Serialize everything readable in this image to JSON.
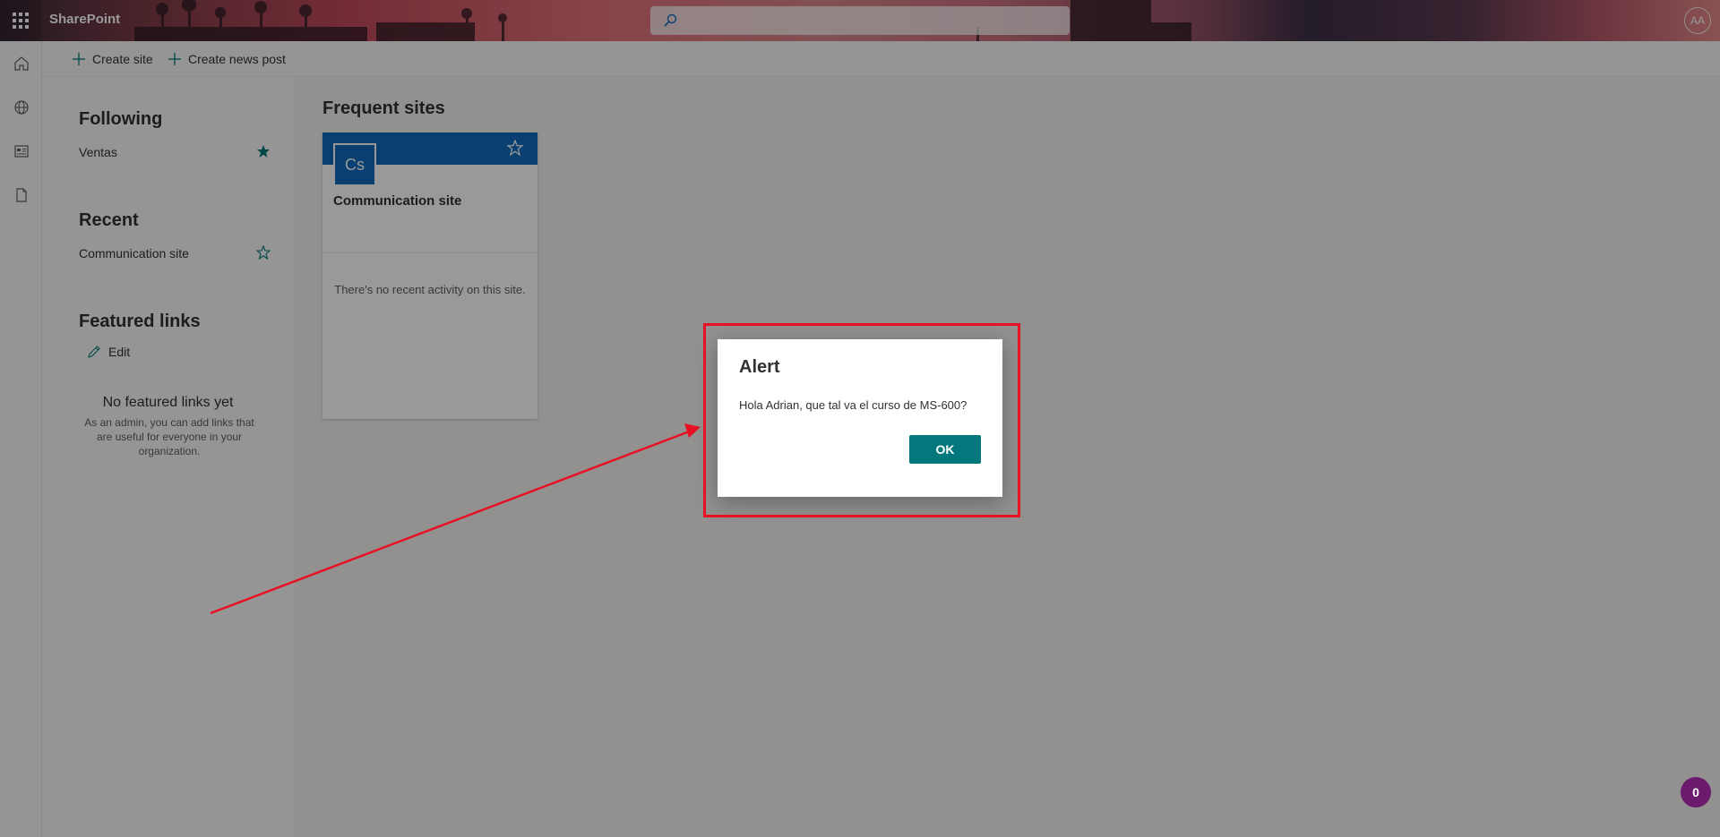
{
  "suite_bar": {
    "app_name": "SharePoint",
    "search_placeholder": "",
    "avatar_initials": "AA"
  },
  "app_bar": {
    "icons": [
      "home-icon",
      "globe-icon",
      "news-icon",
      "document-icon"
    ]
  },
  "command_bar": {
    "create_site": "Create site",
    "create_news_post": "Create news post"
  },
  "left_panel": {
    "following_title": "Following",
    "following_items": [
      {
        "label": "Ventas",
        "starred": true
      }
    ],
    "recent_title": "Recent",
    "recent_items": [
      {
        "label": "Communication site",
        "starred": false
      }
    ],
    "featured_title": "Featured links",
    "edit_label": "Edit",
    "empty_title": "No featured links yet",
    "empty_desc": "As an admin, you can add links that are useful for everyone in your organization."
  },
  "main": {
    "frequent_title": "Frequent sites",
    "card": {
      "logo_text": "Cs",
      "name": "Communication site",
      "activity": "There's no recent activity on this site."
    }
  },
  "dialog": {
    "title": "Alert",
    "message": "Hola Adrian, que tal va el curso de MS-600?",
    "ok_label": "OK"
  },
  "notification": {
    "count": "0"
  },
  "colors": {
    "accent": "#03787c",
    "site_blue": "#0f6cbd",
    "annotation_red": "#e81123",
    "badge_purple": "#6b1a6e",
    "star_teal": "#03787c"
  }
}
